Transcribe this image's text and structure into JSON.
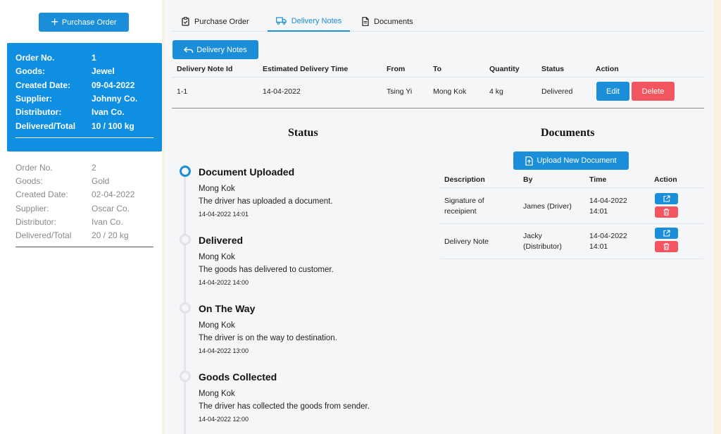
{
  "sidebar": {
    "new_button": {
      "label": "Purchase Order",
      "icon": "plus-icon"
    },
    "orders": [
      {
        "active": true,
        "fields": [
          {
            "label": "Order No.",
            "value": "1"
          },
          {
            "label": "Goods:",
            "value": "Jewel"
          },
          {
            "label": "Created Date:",
            "value": "09-04-2022"
          },
          {
            "label": "Supplier:",
            "value": "Johnny Co."
          },
          {
            "label": "Distributor:",
            "value": "Ivan Co."
          },
          {
            "label": "Delivered/Total",
            "value": "10 / 100 kg"
          }
        ]
      },
      {
        "active": false,
        "fields": [
          {
            "label": "Order No.",
            "value": "2"
          },
          {
            "label": "Goods:",
            "value": "Gold"
          },
          {
            "label": "Created Date:",
            "value": "02-04-2022"
          },
          {
            "label": "Supplier:",
            "value": "Oscar Co."
          },
          {
            "label": "Distributor:",
            "value": "Ivan Co."
          },
          {
            "label": "Delivered/Total",
            "value": "20 / 20 kg"
          }
        ]
      }
    ]
  },
  "tabs": [
    {
      "label": "Purchase Order",
      "icon": "clipboard-icon",
      "active": false
    },
    {
      "label": "Delivery Notes",
      "icon": "truck-icon",
      "active": true
    },
    {
      "label": "Documents",
      "icon": "document-icon",
      "active": false
    }
  ],
  "back_button": {
    "label": "Delivery Notes",
    "icon": "return-arrow-icon"
  },
  "delivery_notes": {
    "headers": [
      "Delivery Note Id",
      "Estimated Delivery Time",
      "From",
      "To",
      "Quantity",
      "Status",
      "Action"
    ],
    "rows": [
      {
        "id": "1-1",
        "eta": "14-04-2022",
        "from": "Tsing Yi",
        "to": "Mong Kok",
        "quantity": "4 kg",
        "status": "Delivered"
      }
    ],
    "edit_label": "Edit",
    "delete_label": "Delete"
  },
  "status_section": {
    "title": "Status",
    "events": [
      {
        "title": "Document Uploaded",
        "location": "Mong Kok",
        "description": "The driver has uploaded a document.",
        "time": "14-04-2022 14:01",
        "current": true
      },
      {
        "title": "Delivered",
        "location": "Mong Kok",
        "description": "The goods has delivered to customer.",
        "time": "14-04-2022 14:00",
        "current": false
      },
      {
        "title": "On The Way",
        "location": "Mong Kok",
        "description": "The driver is on the way to destination.",
        "time": "14-04-2022 13:00",
        "current": false
      },
      {
        "title": "Goods Collected",
        "location": "Mong Kok",
        "description": "The driver has collected the goods from sender.",
        "time": "14-04-2022 12:00",
        "current": false
      }
    ]
  },
  "documents_section": {
    "title": "Documents",
    "upload_label": "Upload New Document",
    "headers": [
      "Description",
      "By",
      "Time",
      "Action"
    ],
    "rows": [
      {
        "description_l1": "Signature of",
        "description_l2": "receipient",
        "by_l1": "James (Driver)",
        "by_l2": "",
        "time_l1": "14-04-2022",
        "time_l2": "14:01"
      },
      {
        "description_l1": "Delivery Note",
        "description_l2": "",
        "by_l1": "Jacky",
        "by_l2": "(Distributor)",
        "time_l1": "14-04-2022",
        "time_l2": "14:01"
      }
    ]
  },
  "colors": {
    "primary": "#1a8ed8",
    "danger": "#f2555f",
    "page_background": "#fbf1e3"
  }
}
